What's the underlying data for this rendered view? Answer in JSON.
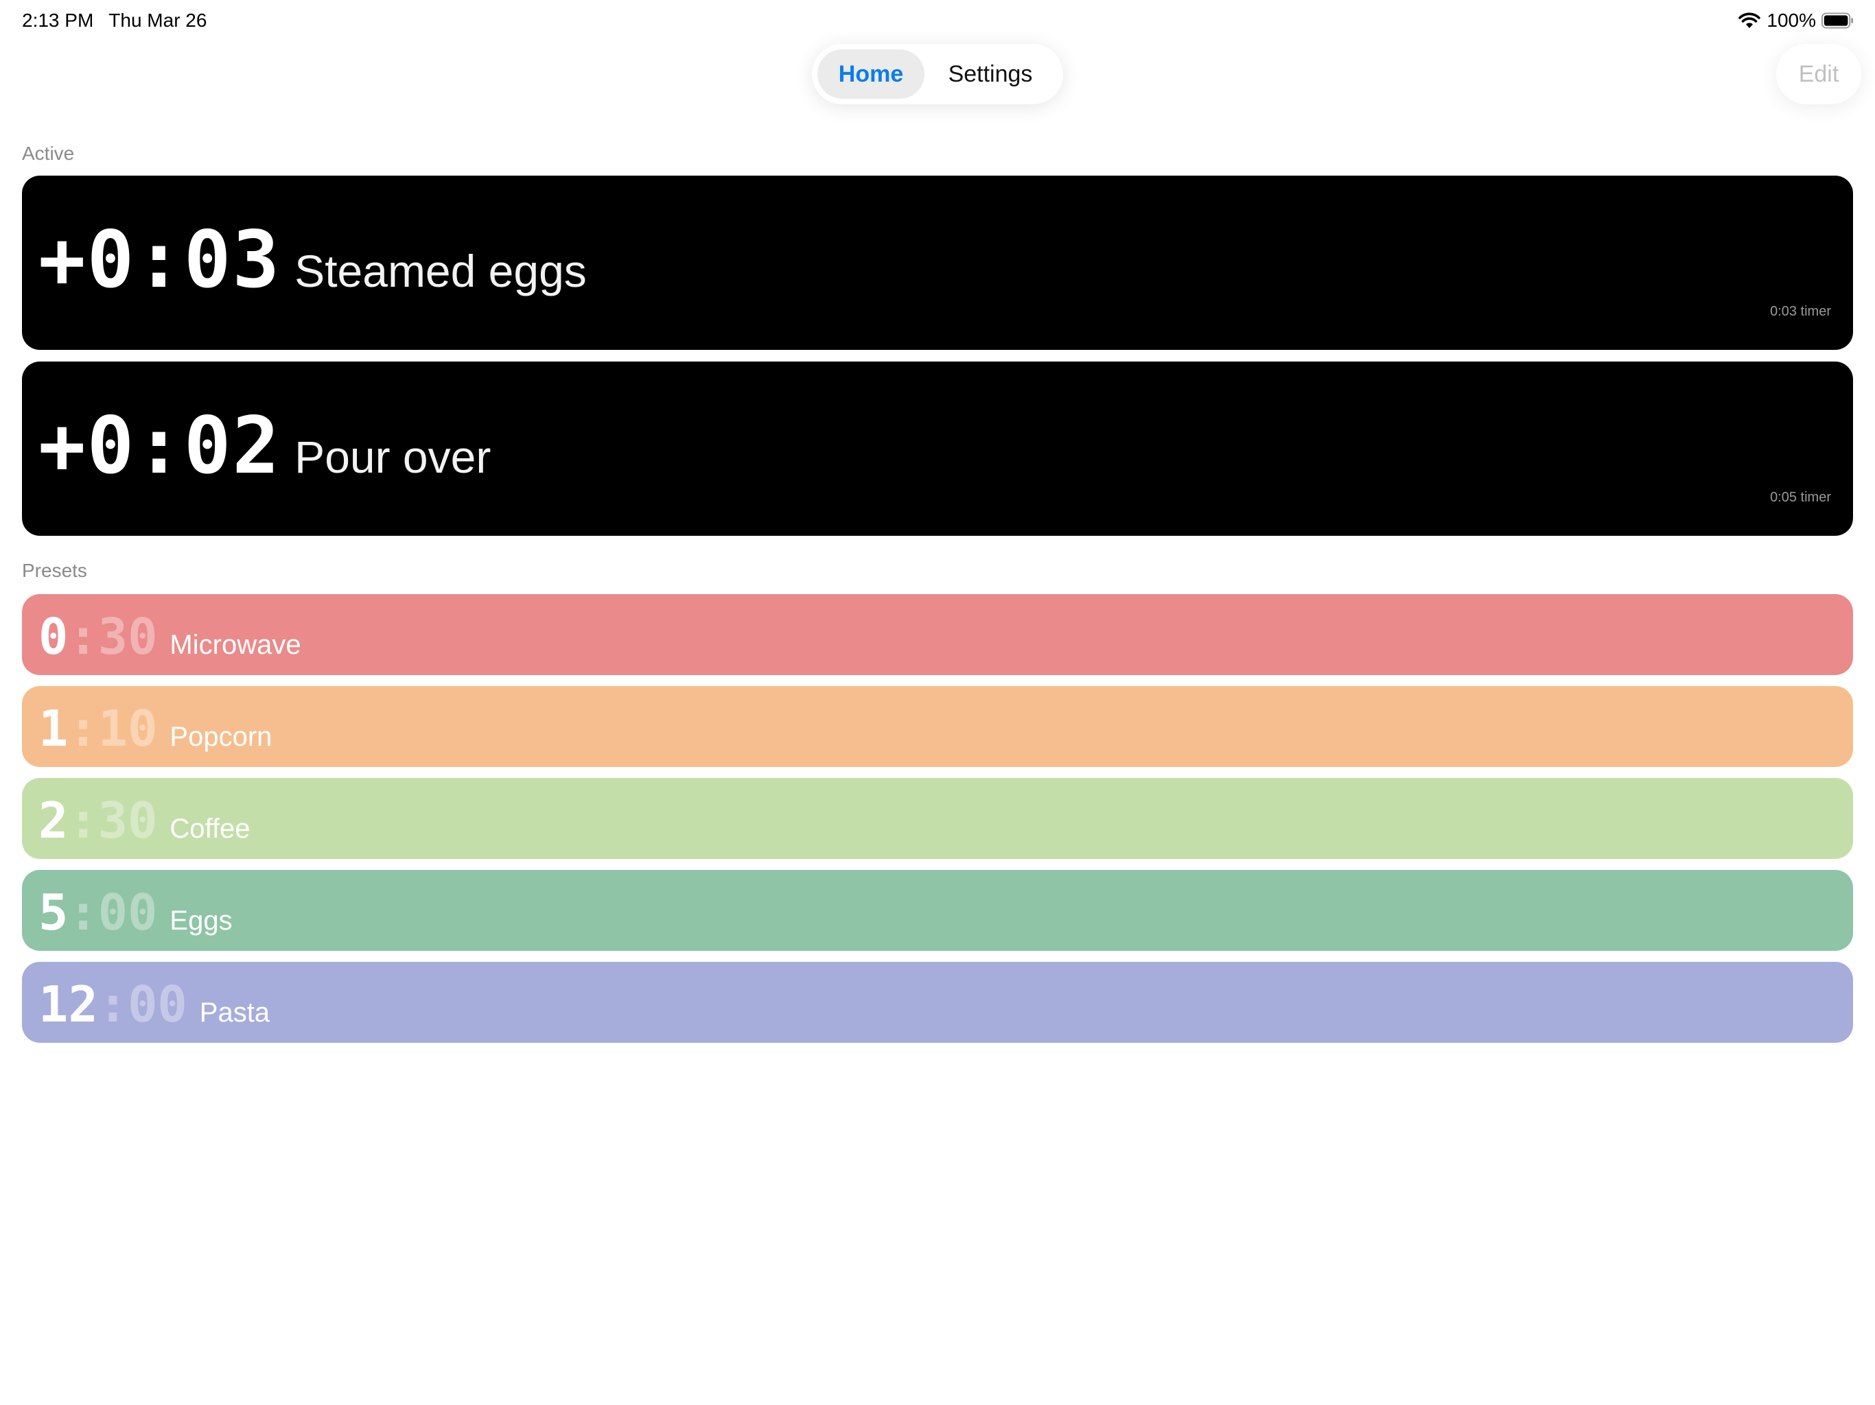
{
  "status_bar": {
    "time": "2:13 PM",
    "date": "Thu Mar 26",
    "battery": "100%",
    "wifi_icon": "wifi-icon",
    "battery_icon": "battery-full-icon"
  },
  "nav": {
    "tabs": [
      {
        "label": "Home",
        "selected": true
      },
      {
        "label": "Settings",
        "selected": false
      }
    ],
    "edit_label": "Edit"
  },
  "active": {
    "section_label": "Active",
    "timers": [
      {
        "elapsed": "+0:03",
        "name": "Steamed eggs",
        "subtitle": "0:03 timer"
      },
      {
        "elapsed": "+0:02",
        "name": "Pour over",
        "subtitle": "0:05 timer"
      }
    ]
  },
  "presets": {
    "section_label": "Presets",
    "items": [
      {
        "minutes": "0",
        "seconds": "30",
        "name": "Microwave",
        "color": "#ea8a8a"
      },
      {
        "minutes": "1",
        "seconds": "10",
        "name": "Popcorn",
        "color": "#f6be8e"
      },
      {
        "minutes": "2",
        "seconds": "30",
        "name": "Coffee",
        "color": "#c4dea9"
      },
      {
        "minutes": "5",
        "seconds": "00",
        "name": "Eggs",
        "color": "#8fc4a6"
      },
      {
        "minutes": "12",
        "seconds": "00",
        "name": "Pasta",
        "color": "#a6addb"
      }
    ]
  },
  "colors": {
    "accent": "#0a7cf0",
    "active_card": "#000000",
    "edit_disabled": "#c0c0c0"
  }
}
